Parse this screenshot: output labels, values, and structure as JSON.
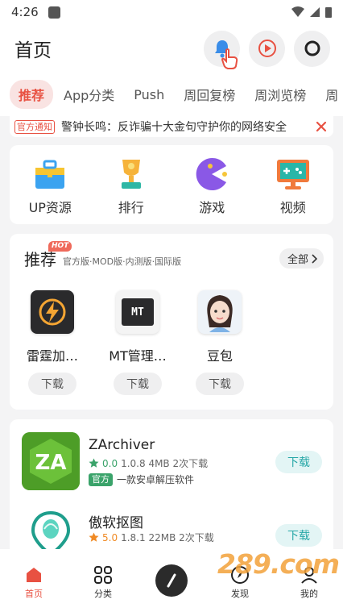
{
  "status_bar": {
    "time": "4:26"
  },
  "header": {
    "title": "首页"
  },
  "tabs": [
    "推荐",
    "App分类",
    "Push",
    "周回复榜",
    "周浏览榜",
    "周"
  ],
  "notice": {
    "badge": "官方通知",
    "text": "警钟长鸣：反诈骗十大金句守护你的网络安全"
  },
  "quick_links": [
    {
      "label": "UP资源",
      "icon": "toolbox-icon"
    },
    {
      "label": "排行",
      "icon": "trophy-icon"
    },
    {
      "label": "游戏",
      "icon": "pacman-icon"
    },
    {
      "label": "视频",
      "icon": "monitor-icon"
    }
  ],
  "recommend": {
    "title": "推荐",
    "hot": "HOT",
    "subtitle": "官方版·MOD版·内测版·国际版",
    "all_label": "全部",
    "apps": [
      {
        "name": "雷霆加…",
        "download": "下载",
        "icon": "lightning-icon"
      },
      {
        "name": "MT管理…",
        "download": "下载",
        "icon": "mt-icon",
        "icon_text": "MT"
      },
      {
        "name": "豆包",
        "download": "下载",
        "icon": "doubao-avatar-icon"
      }
    ]
  },
  "app_list": [
    {
      "name": "ZArchiver",
      "rating": "0.0",
      "meta": "1.0.8 4MB 2次下载",
      "tag": "官方",
      "desc": "一款安卓解压软件",
      "download": "下载",
      "icon_text": "ZA",
      "star_color": "#3aa36a"
    },
    {
      "name": "傲软抠图",
      "rating": "5.0",
      "meta": "1.8.1 22MB 2次下载",
      "download": "下载",
      "star_color": "#f08a24"
    }
  ],
  "bottom_nav": [
    {
      "label": "首页",
      "icon": "home-icon"
    },
    {
      "label": "分类",
      "icon": "grid-icon"
    },
    {
      "label": "发现",
      "icon": "compass-icon"
    },
    {
      "label": "我的",
      "icon": "user-icon"
    }
  ],
  "watermark": "289.com",
  "colors": {
    "accent": "#e85142",
    "download_teal": "#27a7a7",
    "official_green": "#3aa36a"
  }
}
